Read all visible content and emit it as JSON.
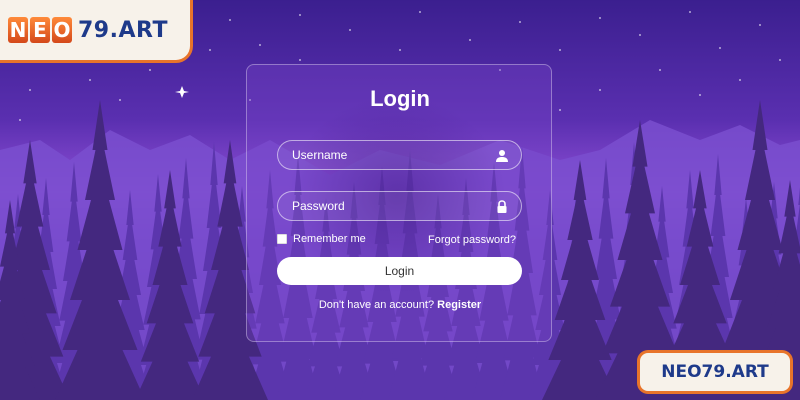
{
  "brand": {
    "logo_top_left": "NEO79.ART",
    "logo_top_left_letters": [
      "N",
      "E",
      "O"
    ],
    "logo_top_left_rest": "79.ART",
    "logo_bottom_right": "NEO79.ART",
    "accent_color": "#e8742a",
    "text_color": "#1e3a8a"
  },
  "login": {
    "title": "Login",
    "username_placeholder": "Username",
    "username_icon": "user-icon",
    "password_placeholder": "Password",
    "password_icon": "lock-icon",
    "remember_label": "Remember me",
    "forgot_label": "Forgot password?",
    "button_label": "Login",
    "register_prompt": "Don't have an account?",
    "register_link": "Register"
  },
  "theme": {
    "sky_top": "#3b1f8f",
    "sky_mid": "#8e4fd6",
    "mountains": "#6f48c4",
    "trees_far": "#5a35a8",
    "trees_near": "#43267f"
  }
}
